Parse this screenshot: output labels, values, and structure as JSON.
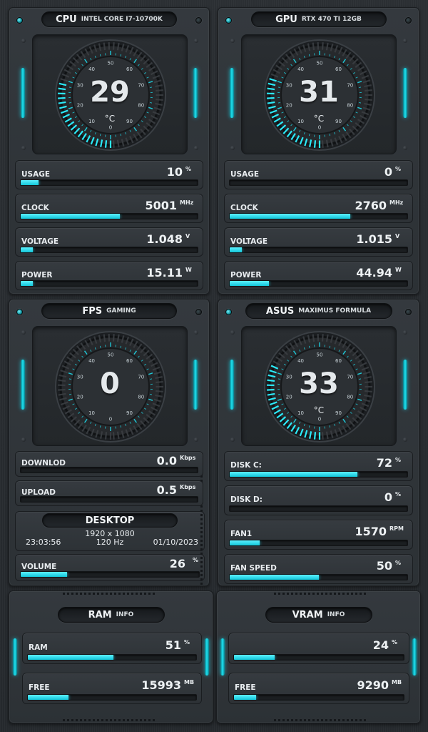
{
  "cpu": {
    "title": "CPU",
    "subtitle": "INTEL CORE I7-10700K",
    "gauge": {
      "value": "29",
      "unit": "°C",
      "level": 29
    },
    "metrics": [
      {
        "label": "USAGE",
        "value": "10",
        "unit": "%",
        "fill": 0.1
      },
      {
        "label": "CLOCK",
        "value": "5001",
        "unit": "MHz",
        "fill": 0.56
      },
      {
        "label": "VOLTAGE",
        "value": "1.048",
        "unit": "V",
        "fill": 0.07
      },
      {
        "label": "POWER",
        "value": "15.11",
        "unit": "W",
        "fill": 0.07
      }
    ]
  },
  "gpu": {
    "title": "GPU",
    "subtitle": "RTX 470 TI 12GB",
    "gauge": {
      "value": "31",
      "unit": "°C",
      "level": 31
    },
    "metrics": [
      {
        "label": "USAGE",
        "value": "0",
        "unit": "%",
        "fill": 0.0
      },
      {
        "label": "CLOCK",
        "value": "2760",
        "unit": "MHz",
        "fill": 0.68
      },
      {
        "label": "VOLTAGE",
        "value": "1.015",
        "unit": "V",
        "fill": 0.07
      },
      {
        "label": "POWER",
        "value": "44.94",
        "unit": "W",
        "fill": 0.22
      }
    ]
  },
  "fps": {
    "title": "FPS",
    "subtitle": "GAMING",
    "gauge": {
      "value": "0",
      "unit": "",
      "level": 0
    },
    "metrics": [
      {
        "label": "DOWNLOD",
        "value": "0.0",
        "unit": "Kbps",
        "fill": 0.0
      },
      {
        "label": "UPLOAD",
        "value": "0.5",
        "unit": "Kbps",
        "fill": 0.0
      }
    ],
    "desktop": {
      "title": "DESKTOP",
      "resolution": "1920 x 1080",
      "refresh": "120 Hz",
      "time": "23:03:56",
      "date": "01/10/2023"
    },
    "volume": {
      "label": "VOLUME",
      "value": "26",
      "unit": "%",
      "fill": 0.26
    }
  },
  "asus": {
    "title": "ASUS",
    "subtitle": "MAXIMUS FORMULA",
    "gauge": {
      "value": "33",
      "unit": "°C",
      "level": 33
    },
    "metrics": [
      {
        "label": "DISK C:",
        "value": "72",
        "unit": "%",
        "fill": 0.72
      },
      {
        "label": "DISK D:",
        "value": "0",
        "unit": "%",
        "fill": 0.0
      },
      {
        "label": "FAN1",
        "value": "1570",
        "unit": "RPM",
        "fill": 0.17
      },
      {
        "label": "FAN SPEED",
        "value": "50",
        "unit": "%",
        "fill": 0.5
      }
    ]
  },
  "ram": {
    "title": "RAM",
    "subtitle": "INFO",
    "metrics": [
      {
        "label": "RAM",
        "value": "51",
        "unit": "%",
        "fill": 0.51
      },
      {
        "label": "FREE",
        "value": "15993",
        "unit": "MB",
        "fill": 0.24
      }
    ]
  },
  "vram": {
    "title": "VRAM",
    "subtitle": "INFO",
    "metrics": [
      {
        "label": "",
        "value": "24",
        "unit": "%",
        "fill": 0.24
      },
      {
        "label": "FREE",
        "value": "9290",
        "unit": "MB",
        "fill": 0.13
      }
    ]
  },
  "gauge_ticks": [
    "0",
    "10",
    "20",
    "30",
    "40",
    "50",
    "60",
    "70",
    "80",
    "90"
  ],
  "colors": {
    "accent": "#1fe5f5",
    "panel": "#31363b",
    "background": "#2a2e32"
  }
}
